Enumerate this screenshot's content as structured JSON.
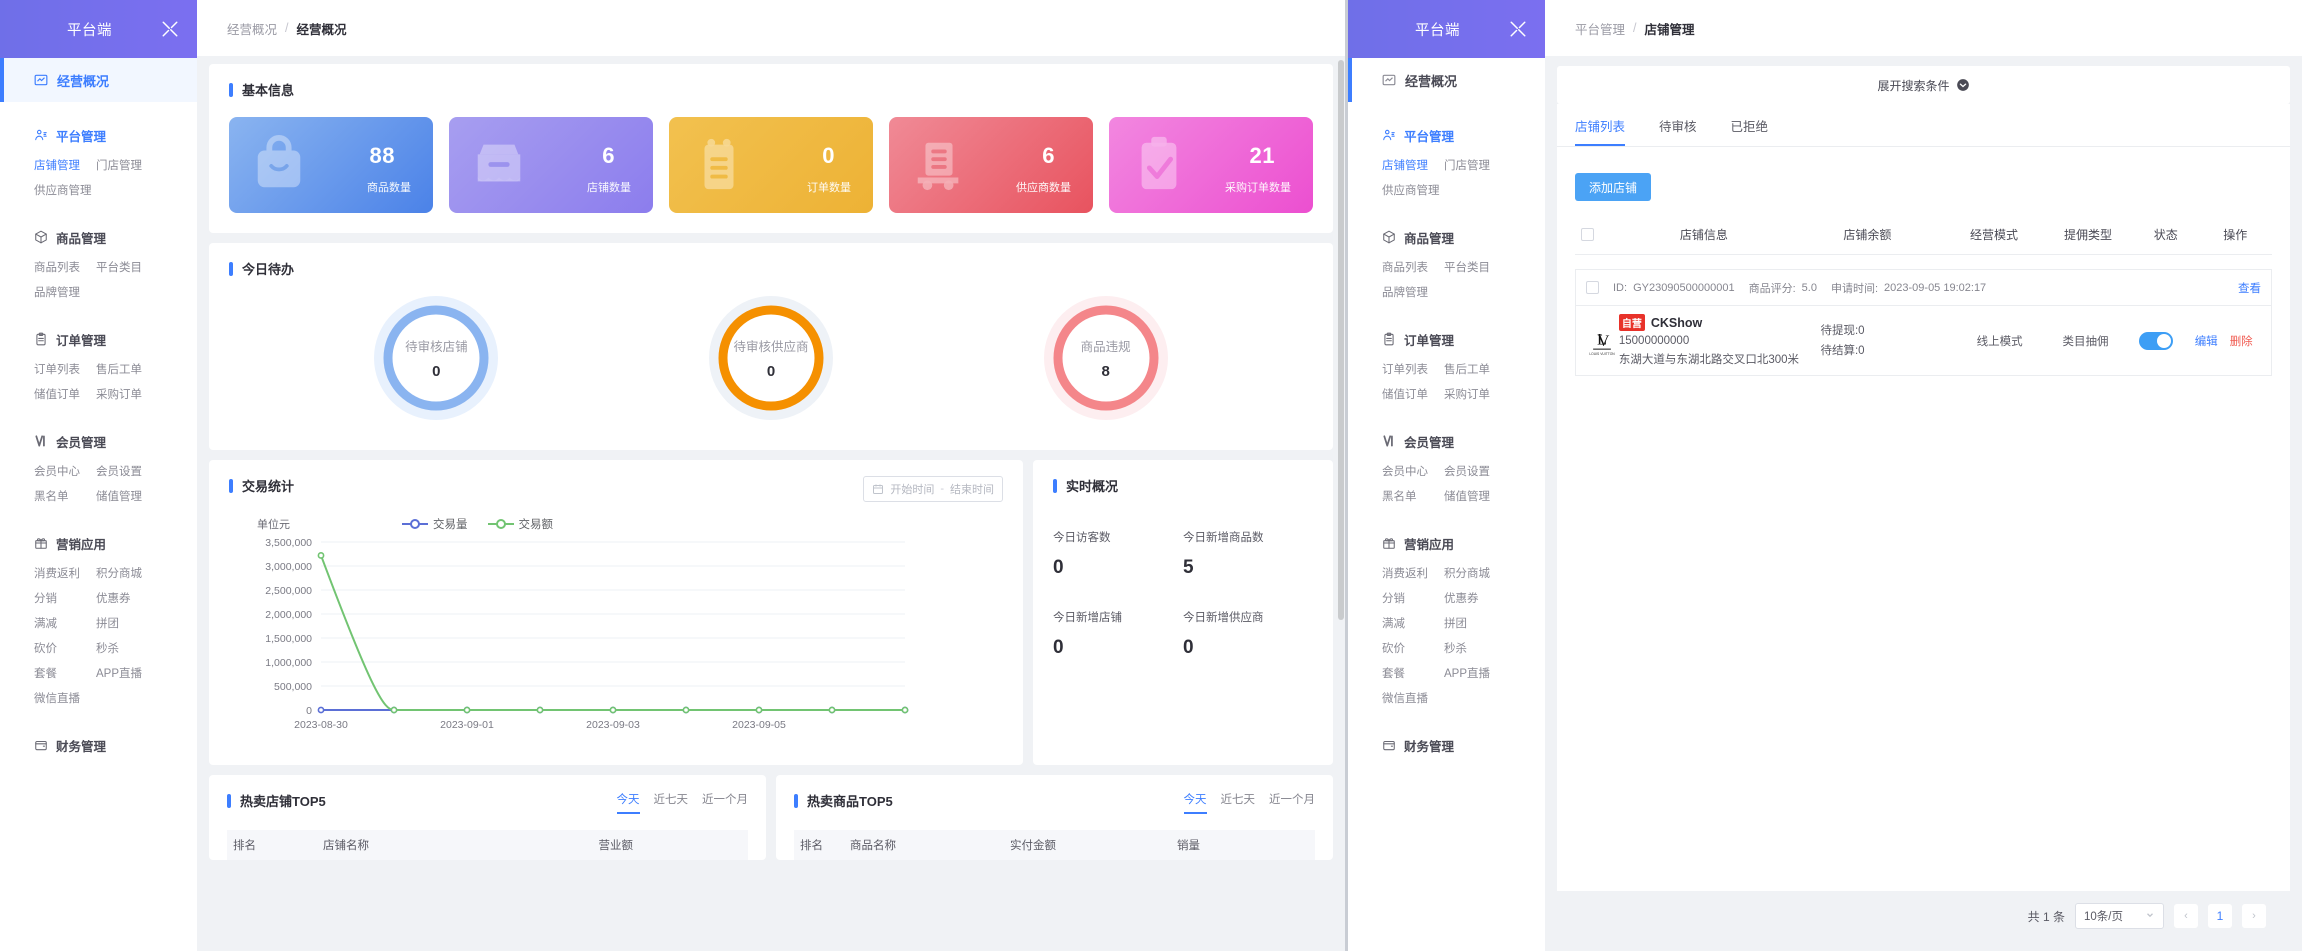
{
  "brand": {
    "title": "平台端",
    "icon": "tools-icon"
  },
  "sidebar": {
    "active": {
      "label": "经营概况",
      "icon": "chart-icon"
    },
    "groups": [
      {
        "title": "平台管理",
        "icon": "users-icon",
        "accent": true,
        "links": [
          "店铺管理",
          "门店管理",
          "供应商管理"
        ]
      },
      {
        "title": "商品管理",
        "icon": "box-icon",
        "accent": false,
        "links": [
          "商品列表",
          "平台类目",
          "品牌管理"
        ]
      },
      {
        "title": "订单管理",
        "icon": "clipboard-icon",
        "accent": false,
        "links": [
          "订单列表",
          "售后工单",
          "储值订单",
          "采购订单"
        ]
      },
      {
        "title": "会员管理",
        "icon": "vip-icon",
        "accent": false,
        "links": [
          "会员中心",
          "会员设置",
          "黑名单",
          "储值管理"
        ]
      },
      {
        "title": "营销应用",
        "icon": "gift-icon",
        "accent": false,
        "links": [
          "消费返利",
          "积分商城",
          "分销",
          "优惠券",
          "满减",
          "拼团",
          "砍价",
          "秒杀",
          "套餐",
          "APP直播",
          "微信直播"
        ]
      },
      {
        "title": "财务管理",
        "icon": "wallet-icon",
        "accent": false,
        "links": []
      }
    ]
  },
  "left_window": {
    "breadcrumb": {
      "parent": "经营概况",
      "sep": "/",
      "current": "经营概况"
    },
    "basic_info": {
      "title": "基本信息",
      "tiles": [
        {
          "value": "88",
          "label": "商品数量",
          "icon": "bag-icon",
          "c1": "#8ab4f0",
          "c2": "#4b82e8"
        },
        {
          "value": "6",
          "label": "店铺数量",
          "icon": "shop-icon",
          "c1": "#a79ef0",
          "c2": "#8c7ded"
        },
        {
          "value": "0",
          "label": "订单数量",
          "icon": "receipt-icon",
          "c1": "#f2c14f",
          "c2": "#edb235"
        },
        {
          "value": "6",
          "label": "供应商数量",
          "icon": "truck-icon",
          "c1": "#f08a96",
          "c2": "#e8535f"
        },
        {
          "value": "21",
          "label": "采购订单数量",
          "icon": "checklist-icon",
          "c1": "#f287e0",
          "c2": "#ec4fd0"
        }
      ]
    },
    "todo": {
      "title": "今日待办",
      "items": [
        {
          "label": "待审核店铺",
          "value": "0",
          "color": "#8ab4f0",
          "ring": "#e8f1fd"
        },
        {
          "label": "待审核供应商",
          "value": "0",
          "color": "#f59000",
          "ring": "#eef2f7"
        },
        {
          "label": "商品违规",
          "value": "8",
          "color": "#f4868a",
          "ring": "#fdeef0"
        }
      ]
    },
    "trade": {
      "title": "交易统计",
      "date_start_placeholder": "开始时间",
      "date_dash": "-",
      "date_end_placeholder": "结束时间"
    },
    "realtime": {
      "title": "实时概况",
      "items": [
        {
          "label": "今日访客数",
          "value": "0"
        },
        {
          "label": "今日新增商品数",
          "value": "5"
        },
        {
          "label": "今日新增店铺",
          "value": "0"
        },
        {
          "label": "今日新增供应商",
          "value": "0"
        }
      ]
    },
    "top_shops": {
      "title": "热卖店铺TOP5",
      "tabs": [
        "今天",
        "近七天",
        "近一个月"
      ],
      "active_tab": "今天",
      "columns": [
        "排名",
        "店铺名称",
        "营业额"
      ]
    },
    "top_goods": {
      "title": "热卖商品TOP5",
      "tabs": [
        "今天",
        "近七天",
        "近一个月"
      ],
      "active_tab": "今天",
      "columns": [
        "排名",
        "商品名称",
        "实付金额",
        "销量"
      ]
    }
  },
  "chart_data": {
    "type": "line",
    "title": "交易统计",
    "ylabel": "单位元",
    "xlabel": "",
    "grid": true,
    "legend_position": "top",
    "ylim": [
      0,
      3500000
    ],
    "yticks": [
      "0",
      "500,000",
      "1,000,000",
      "1,500,000",
      "2,000,000",
      "2,500,000",
      "3,000,000",
      "3,500,000"
    ],
    "xticks": [
      "2023-08-30",
      "2023-09-01",
      "2023-09-03",
      "2023-09-05"
    ],
    "x": [
      "2023-08-30",
      "2023-08-31",
      "2023-09-01",
      "2023-09-02",
      "2023-09-03",
      "2023-09-04",
      "2023-09-05",
      "2023-09-06",
      "2023-09-07"
    ],
    "series": [
      {
        "name": "交易量",
        "color": "#5b6fd6",
        "values": [
          0,
          0,
          0,
          0,
          0,
          0,
          0,
          0,
          0
        ]
      },
      {
        "name": "交易额",
        "color": "#72c472",
        "values": [
          3220000,
          0,
          0,
          0,
          0,
          0,
          0,
          0,
          0
        ]
      }
    ]
  },
  "right_window": {
    "breadcrumb": {
      "parent": "平台管理",
      "sep": "/",
      "current": "店铺管理"
    },
    "search_toggle": {
      "label": "展开搜索条件",
      "icon": "chevron-down-icon"
    },
    "tabs": [
      "店铺列表",
      "待审核",
      "已拒绝"
    ],
    "active_tab": "店铺列表",
    "add_button": "添加店铺",
    "table": {
      "columns": [
        "店铺信息",
        "店铺余额",
        "经营模式",
        "提佣类型",
        "状态",
        "操作"
      ],
      "rows": [
        {
          "meta": {
            "id_label": "ID:",
            "id_value": "GY23090500000001",
            "rating_label": "商品评分:",
            "rating_value": "5.0",
            "apply_label": "申请时间:",
            "apply_value": "2023-09-05 19:02:17",
            "view": "查看"
          },
          "badge": "自营",
          "name": "CKShow",
          "phone": "15000000000",
          "address": "东湖大道与东湖北路交叉口北300米",
          "balance": [
            "待提现:0",
            "待结算:0"
          ],
          "mode": "线上模式",
          "commission": "类目抽佣",
          "status_on": true,
          "actions": [
            "编辑",
            "删除"
          ]
        }
      ]
    },
    "pagination": {
      "total": "共 1 条",
      "page_size": "10条/页",
      "prev": "‹",
      "current_page": "1",
      "next": "›"
    }
  }
}
